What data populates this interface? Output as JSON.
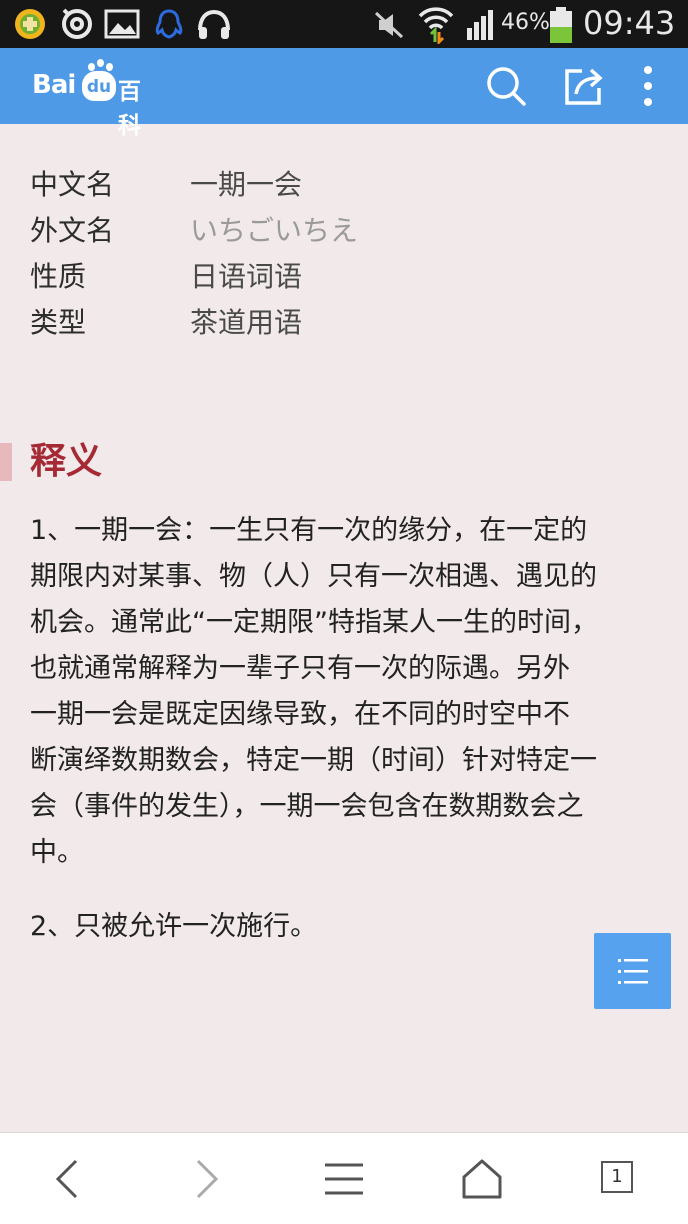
{
  "status_bar": {
    "battery": "46%",
    "time": "09:43",
    "icons": [
      "game-icon",
      "weibo-icon",
      "gallery-icon",
      "qq-icon",
      "headset-icon",
      "mute-icon",
      "wifi-icon",
      "signal-icon",
      "battery-icon"
    ]
  },
  "header": {
    "logo": {
      "bai": "Bai",
      "du": "du",
      "baike": "百科"
    },
    "icons": [
      "search-icon",
      "share-icon",
      "more-icon"
    ]
  },
  "infobox": [
    {
      "label": "中文名",
      "value": "一期一会"
    },
    {
      "label": "外文名",
      "value": "いちごいちえ"
    },
    {
      "label": "性质",
      "value": "日语词语"
    },
    {
      "label": "类型",
      "value": "茶道用语"
    }
  ],
  "section": {
    "title": "释义",
    "paragraph1": [
      "1、一期一会：一生只有一次的缘分，在一定的",
      "期限内对某事、物（人）只有一次相遇、遇见的",
      "机会。通常此“一定期限”特指某人一生的时间，",
      "也就通常解释为一辈子只有一次的际遇。另外",
      "一期一会是既定因缘导致，在不同的时空中不",
      "断演绎数期数会，特定一期（时间）针对特定一",
      "会（事件的发生），一期一会包含在数期数会之",
      "中。"
    ],
    "paragraph2": "2、只被允许一次施行。"
  },
  "bottom_bar": {
    "tab_count": "1",
    "icons": [
      "back-icon",
      "forward-icon",
      "menu-icon",
      "home-icon",
      "tabs-icon"
    ]
  },
  "colors": {
    "header_bg": "#4f9ae6",
    "page_bg": "#f2eaea",
    "section_title": "#a52a36",
    "toc_button": "#56a2ee"
  }
}
